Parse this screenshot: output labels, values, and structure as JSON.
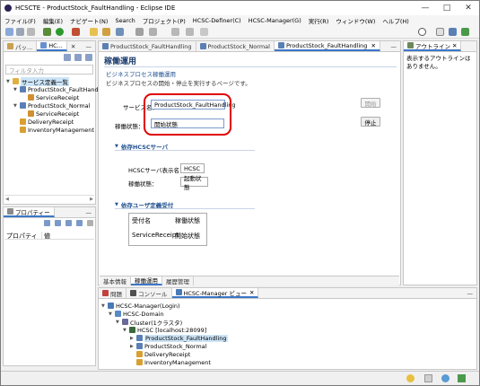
{
  "window": {
    "title": "HCSCTE - ProductStock_FaultHandling - Eclipse IDE"
  },
  "menu": [
    "ファイル(F)",
    "編集(E)",
    "ナビゲート(N)",
    "Search",
    "プロジェクト(P)",
    "HCSC-Definer(C)",
    "HCSC-Manager(G)",
    "実行(R)",
    "ウィンドウ(W)",
    "ヘルプ(H)"
  ],
  "left_panel": {
    "tabs": [
      "パッ...",
      "HC..."
    ],
    "filter_placeholder": "フィルタ入力",
    "tree": [
      {
        "label": "サービス定義一覧",
        "level": 0,
        "selected": true
      },
      {
        "label": "ProductStock_FaultHandli",
        "level": 1
      },
      {
        "label": "ServiceReceipt",
        "level": 2
      },
      {
        "label": "ProductStock_Normal",
        "level": 1
      },
      {
        "label": "ServiceReceipt",
        "level": 2
      },
      {
        "label": "DeliveryReceipt",
        "level": 1
      },
      {
        "label": "InventoryManagement",
        "level": 1
      }
    ]
  },
  "props_panel": {
    "tab": "プロパティー",
    "col_property": "プロパティ",
    "col_value": "値"
  },
  "editor": {
    "tabs": [
      "ProductStock_FaultHandling",
      "ProductStock_Normal",
      "ProductStock_FaultHandling"
    ],
    "heading": "稼働運用",
    "subheading": "ビジネスプロセス稼働運用",
    "description": "ビジネスプロセスの開始・停止を実行するページです。",
    "service_label": "サービス名：",
    "service_value": "ProductStock_FaultHandling",
    "state_label": "稼働状態：",
    "state_value": "開始状態",
    "start_button": "開始",
    "stop_button": "停止",
    "sec_server": "依存HCSCサーバ",
    "server_name_label": "HCSCサーバ表示名：",
    "server_name_value": "HCSC",
    "run_state_label": "稼働状態：",
    "run_state_value": "起動状態",
    "sec_user": "依存ユーザ定義受付",
    "recv_col1": "受付名",
    "recv_col2": "稼働状態",
    "recv_row1": "ServiceReceipt",
    "recv_row2": "開始状態",
    "bottom_tabs": [
      "基本情報",
      "稼働運用",
      "履歴管理"
    ]
  },
  "outline": {
    "tab": "アウトライン",
    "message": "表示するアウトラインはありません。"
  },
  "bottom": {
    "tabs": [
      "問題",
      "コンソール",
      "HCSC-Manager ビュー"
    ],
    "tree": [
      {
        "label": "HCSC-Manager(Login)",
        "level": 0
      },
      {
        "label": "HCSC-Domain",
        "level": 1
      },
      {
        "label": "Cluster(1クラスタ)",
        "level": 2
      },
      {
        "label": "HCSC [localhost:28099]",
        "level": 3
      },
      {
        "label": "ProductStock_FaultHandling",
        "level": 4,
        "selected": true
      },
      {
        "label": "ProductStock_Normal",
        "level": 4
      },
      {
        "label": "DeliveryReceipt",
        "level": 4
      },
      {
        "label": "InventoryManagement",
        "level": 4
      }
    ]
  }
}
